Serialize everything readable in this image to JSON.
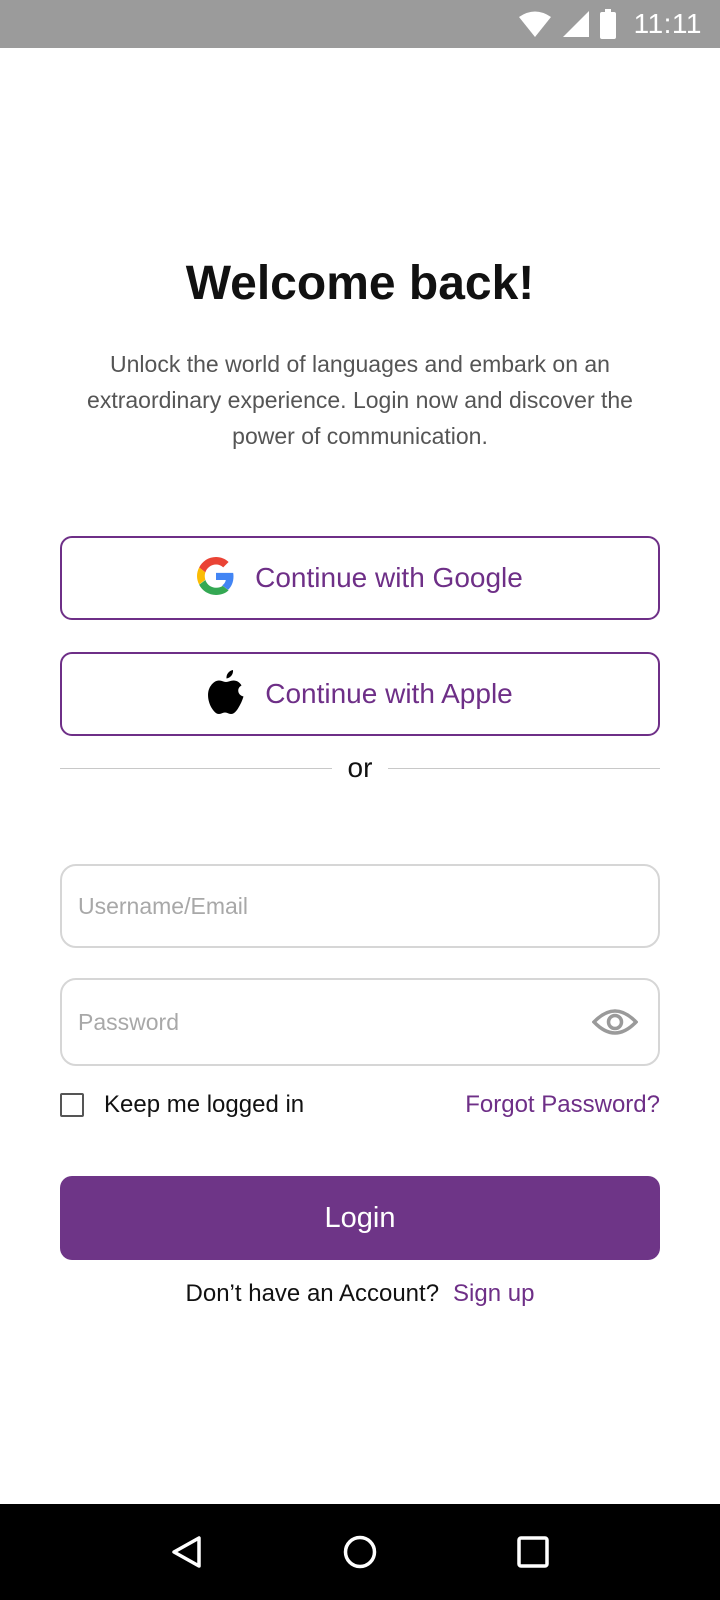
{
  "status_bar": {
    "time": "11:11",
    "icons": [
      "wifi-icon",
      "cell-signal-icon",
      "battery-icon"
    ]
  },
  "login": {
    "title": "Welcome back!",
    "subtitle": "Unlock the world of languages and embark on an extraordinary experience. Login now and discover the power of communication.",
    "google_label": "Continue with Google",
    "apple_label": "Continue with Apple",
    "divider_text": "or",
    "username_placeholder": "Username/Email",
    "username_value": "",
    "password_placeholder": "Password",
    "password_value": "",
    "keep_logged_in_label": "Keep me logged in",
    "keep_logged_in_checked": false,
    "forgot_password_label": "Forgot Password?",
    "login_label": "Login",
    "signup_prompt": "Don’t have an Account?",
    "signup_label": "Sign up"
  },
  "nav_bar": {
    "icons": [
      "back-icon",
      "home-icon",
      "recents-icon"
    ]
  },
  "colors": {
    "accent": "#6e2f87",
    "login_button": "#6e3587",
    "status_bar": "#9b9b9b",
    "nav_bar": "#000000"
  }
}
